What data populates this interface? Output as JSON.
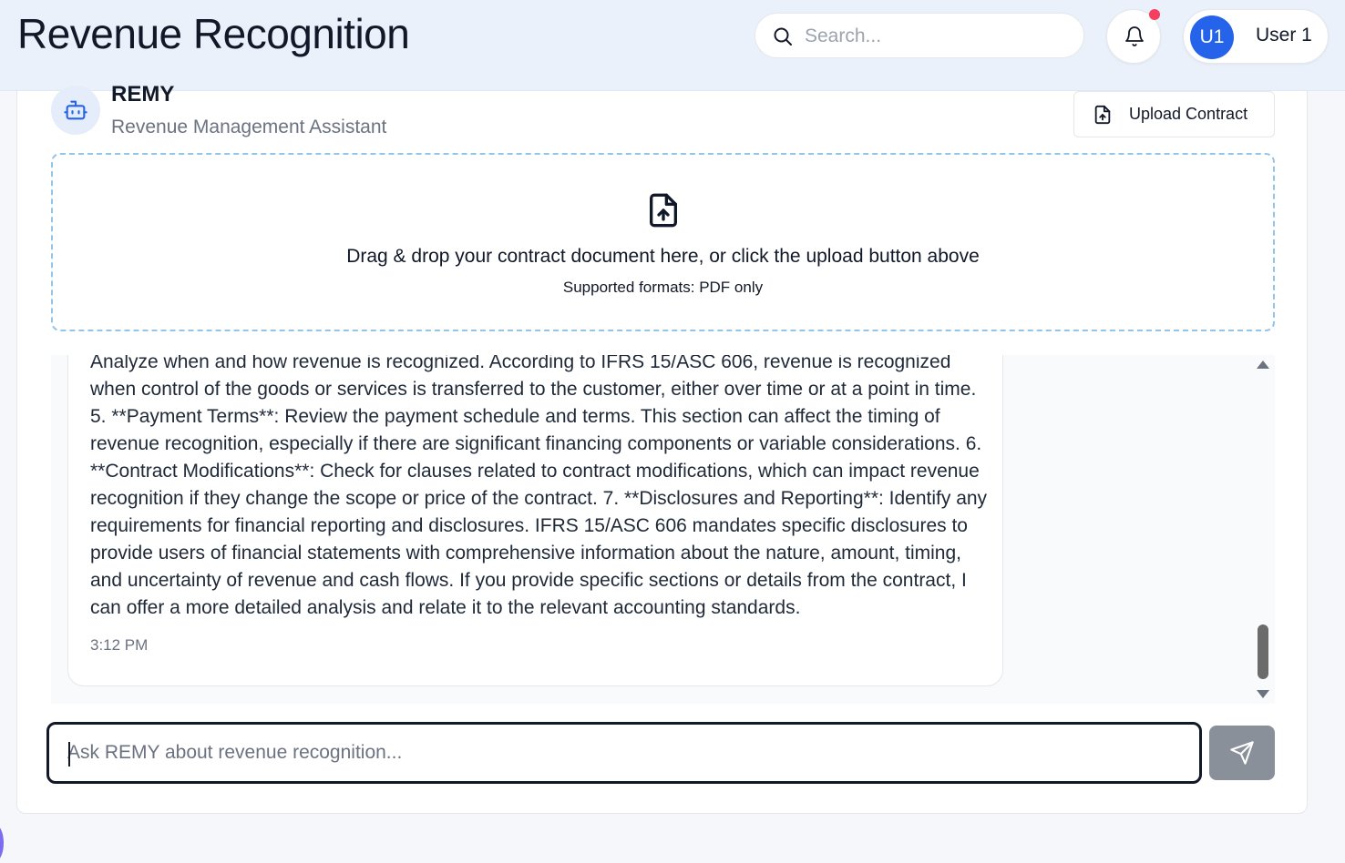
{
  "header": {
    "title": "Revenue Recognition",
    "search_placeholder": "Search...",
    "user_initials": "U1",
    "user_name": "User 1"
  },
  "assistant": {
    "name": "REMY",
    "subtitle": "Revenue Management Assistant",
    "upload_label": "Upload Contract"
  },
  "dropzone": {
    "text": "Drag & drop your contract document here, or click the upload button above",
    "subtext": "Supported formats: PDF only"
  },
  "message": {
    "text": "Analyze when and how revenue is recognized. According to IFRS 15/ASC 606, revenue is recognized when control of the goods or services is transferred to the customer, either over time or at a point in time. 5. **Payment Terms**: Review the payment schedule and terms. This section can affect the timing of revenue recognition, especially if there are significant financing components or variable considerations. 6. **Contract Modifications**: Check for clauses related to contract modifications, which can impact revenue recognition if they change the scope or price of the contract. 7. **Disclosures and Reporting**: Identify any requirements for financial reporting and disclosures. IFRS 15/ASC 606 mandates specific disclosures to provide users of financial statements with comprehensive information about the nature, amount, timing, and uncertainty of revenue and cash flows. If you provide specific sections or details from the contract, I can offer a more detailed analysis and relate it to the relevant accounting standards.",
    "time": "3:12 PM"
  },
  "chat_input": {
    "placeholder": "Ask REMY about revenue recognition..."
  },
  "colors": {
    "header_bg": "#eaf1fb",
    "avatar_bg": "#2563eb",
    "notification_dot": "#f43f5e",
    "send_button_bg": "#8a9099",
    "dropzone_border": "#93c5e9"
  }
}
